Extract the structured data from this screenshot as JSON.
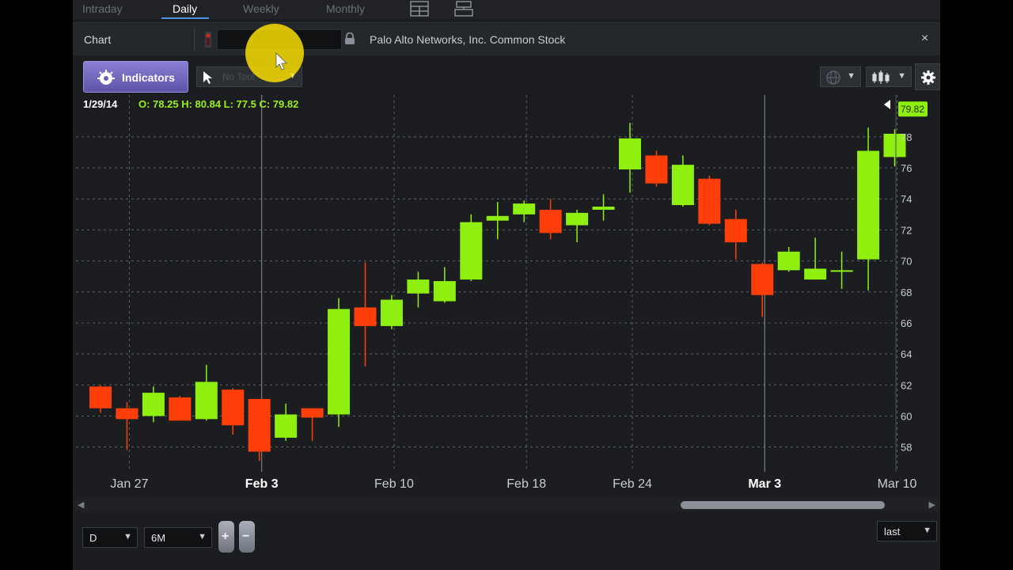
{
  "tabs": [
    {
      "label": "Intraday",
      "active": false
    },
    {
      "label": "Daily",
      "active": true
    },
    {
      "label": "Weekly",
      "active": false
    },
    {
      "label": "Monthly",
      "active": false
    }
  ],
  "header": {
    "chart_label": "Chart",
    "symbol_value": "",
    "company_name": "Palo Alto Networks, Inc. Common Stock",
    "close_glyph": "×"
  },
  "toolbar": {
    "indicators_label": "Indicators",
    "tool_placeholder": "No Tool",
    "caret": "▼"
  },
  "ohlc": {
    "date": "1/29/14",
    "text": "O: 78.25 H: 80.84 L: 77.5 C: 79.82"
  },
  "chart_data": {
    "type": "candlestick",
    "up_color": "#8ff010",
    "down_color": "#ff3f0a",
    "last_price_label": "79.82",
    "last_price": 79.82,
    "ylim": [
      56.4,
      80.7
    ],
    "yticks": [
      58,
      60,
      62,
      64,
      66,
      68,
      70,
      72,
      74,
      76,
      78
    ],
    "grid": true,
    "x_labels": [
      {
        "label": "Jan 27",
        "index": 1,
        "bold": false
      },
      {
        "label": "Feb 3",
        "index": 6,
        "bold": true
      },
      {
        "label": "Feb 10",
        "index": 11,
        "bold": false
      },
      {
        "label": "Feb 18",
        "index": 16,
        "bold": false
      },
      {
        "label": "Feb 24",
        "index": 20,
        "bold": false
      },
      {
        "label": "Mar 3",
        "index": 25,
        "bold": true
      },
      {
        "label": "Mar 10",
        "index": 30,
        "bold": false
      }
    ],
    "candles": [
      {
        "o": 61.9,
        "h": 62.0,
        "l": 60.2,
        "c": 60.5
      },
      {
        "o": 60.5,
        "h": 60.9,
        "l": 57.8,
        "c": 59.8
      },
      {
        "o": 60.0,
        "h": 61.9,
        "l": 59.6,
        "c": 61.5
      },
      {
        "o": 61.2,
        "h": 61.3,
        "l": 59.7,
        "c": 59.7
      },
      {
        "o": 59.8,
        "h": 63.3,
        "l": 59.7,
        "c": 62.2
      },
      {
        "o": 61.7,
        "h": 61.8,
        "l": 58.8,
        "c": 59.4
      },
      {
        "o": 61.1,
        "h": 61.1,
        "l": 57.1,
        "c": 57.7
      },
      {
        "o": 58.6,
        "h": 60.8,
        "l": 58.4,
        "c": 60.1
      },
      {
        "o": 60.5,
        "h": 60.5,
        "l": 58.4,
        "c": 59.9
      },
      {
        "o": 60.1,
        "h": 67.6,
        "l": 59.3,
        "c": 66.9
      },
      {
        "o": 67.0,
        "h": 69.9,
        "l": 63.2,
        "c": 65.8
      },
      {
        "o": 65.8,
        "h": 67.8,
        "l": 65.6,
        "c": 67.5
      },
      {
        "o": 67.9,
        "h": 69.3,
        "l": 67.0,
        "c": 68.8
      },
      {
        "o": 67.4,
        "h": 69.6,
        "l": 67.3,
        "c": 68.7
      },
      {
        "o": 68.8,
        "h": 73.0,
        "l": 68.7,
        "c": 72.5
      },
      {
        "o": 72.6,
        "h": 73.8,
        "l": 71.4,
        "c": 72.9
      },
      {
        "o": 73.0,
        "h": 73.9,
        "l": 72.5,
        "c": 73.7
      },
      {
        "o": 73.3,
        "h": 74.0,
        "l": 71.4,
        "c": 71.8
      },
      {
        "o": 72.3,
        "h": 73.3,
        "l": 71.2,
        "c": 73.1
      },
      {
        "o": 73.3,
        "h": 74.3,
        "l": 72.6,
        "c": 73.5
      },
      {
        "o": 75.9,
        "h": 78.9,
        "l": 74.4,
        "c": 77.9
      },
      {
        "o": 76.8,
        "h": 77.1,
        "l": 74.8,
        "c": 75.0
      },
      {
        "o": 73.6,
        "h": 76.8,
        "l": 73.5,
        "c": 76.2
      },
      {
        "o": 75.3,
        "h": 75.5,
        "l": 72.3,
        "c": 72.4
      },
      {
        "o": 72.7,
        "h": 73.3,
        "l": 70.1,
        "c": 71.2
      },
      {
        "o": 69.8,
        "h": 69.9,
        "l": 66.4,
        "c": 67.8
      },
      {
        "o": 69.4,
        "h": 70.9,
        "l": 69.3,
        "c": 70.6
      },
      {
        "o": 68.8,
        "h": 71.5,
        "l": 68.8,
        "c": 69.5
      },
      {
        "o": 69.3,
        "h": 70.6,
        "l": 68.2,
        "c": 69.4
      },
      {
        "o": 70.1,
        "h": 78.6,
        "l": 68.1,
        "c": 77.1
      },
      {
        "o": 76.7,
        "h": 78.5,
        "l": 76.1,
        "c": 78.2
      }
    ]
  },
  "bottom": {
    "period_value": "D",
    "range_value": "6M",
    "zoom_in_glyph": "+",
    "zoom_out_glyph": "−",
    "price_type_value": "last"
  },
  "scroll": {
    "left_glyph": "◀",
    "right_glyph": "▶"
  }
}
